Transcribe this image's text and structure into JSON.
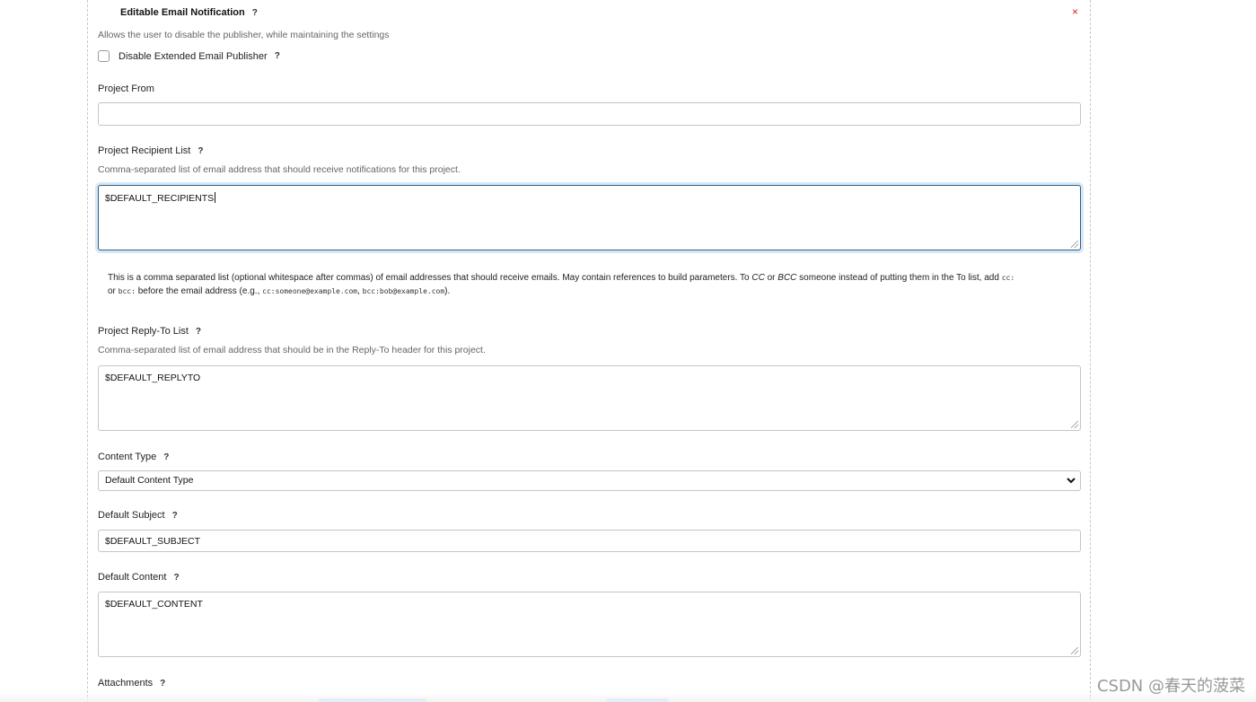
{
  "section": {
    "title": "Editable Email Notification",
    "help": "?",
    "close": "×",
    "publisher_desc": "Allows the user to disable the publisher, while maintaining the settings",
    "disable_label": "Disable Extended Email Publisher",
    "disable_checked": false
  },
  "project_from": {
    "label": "Project From",
    "value": ""
  },
  "recipient_list": {
    "label": "Project Recipient List",
    "desc": "Comma-separated list of email address that should receive notifications for this project.",
    "value": "$DEFAULT_RECIPIENTS",
    "help_text_1": "This is a comma separated list (optional whitespace after commas) of email addresses that should receive emails. May contain references to build parameters. To ",
    "cc_word": "CC",
    "or_word": " or ",
    "bcc_word": "BCC",
    "help_text_2": " someone instead of putting them in the To list, add ",
    "cc_prefix": "cc:",
    "help_or2": "or ",
    "bcc_prefix": "bcc:",
    "help_text_3": " before the email address (e.g., ",
    "example1": "cc:someone@example.com",
    "comma": ", ",
    "example2": "bcc:bob@example.com",
    "help_end": ")."
  },
  "replyto_list": {
    "label": "Project Reply-To List",
    "desc": "Comma-separated list of email address that should be in the Reply-To header for this project.",
    "value": "$DEFAULT_REPLYTO"
  },
  "content_type": {
    "label": "Content Type",
    "selected": "Default Content Type"
  },
  "default_subject": {
    "label": "Default Subject",
    "value": "$DEFAULT_SUBJECT"
  },
  "default_content": {
    "label": "Default Content",
    "value": "$DEFAULT_CONTENT"
  },
  "attachments": {
    "label": "Attachments"
  },
  "watermark": "CSDN @春天的菠菜",
  "colors": {
    "close": "#dd2222",
    "focus_border": "#2d5f86",
    "focus_glow": "#d7e7f5"
  }
}
